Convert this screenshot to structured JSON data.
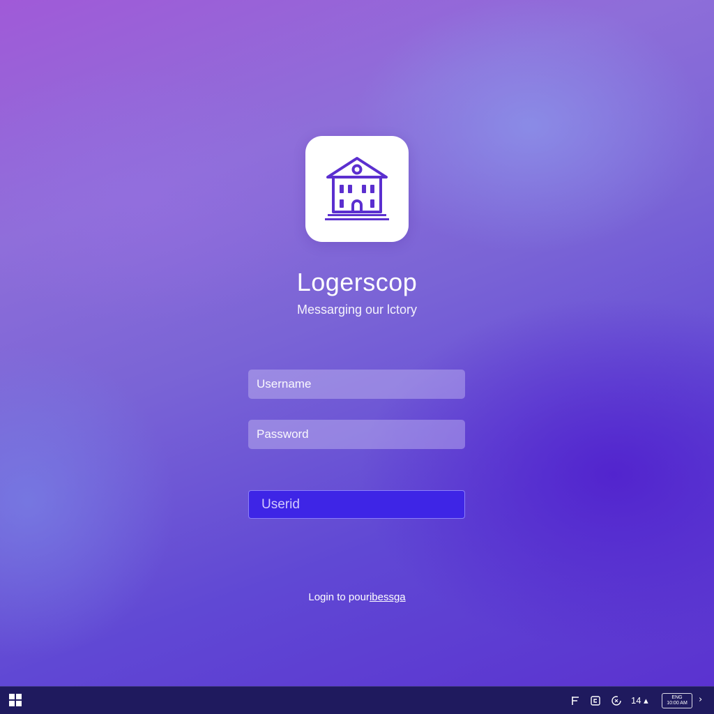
{
  "app": {
    "logo_icon": "bank-building-icon",
    "title": "Logerscop",
    "subtitle": "Messarging our lctory"
  },
  "form": {
    "username_placeholder": "Username",
    "password_placeholder": "Password",
    "submit_label": "Userid"
  },
  "footer": {
    "prefix": "Login to pour",
    "link": "ibessga"
  },
  "taskbar": {
    "start_icon": "windows-start-icon",
    "tray_icons": [
      "flag-icon",
      "chat-icon",
      "refresh-icon"
    ],
    "tray_number": "14 ▴",
    "clock_line1": "ENG",
    "clock_line2": "10:00 AM",
    "overflow_icon": "chevron-right-icon"
  },
  "colors": {
    "accent": "#3e25e6",
    "logo_icon": "#5b2fcf",
    "taskbar": "#1f1a5e"
  }
}
